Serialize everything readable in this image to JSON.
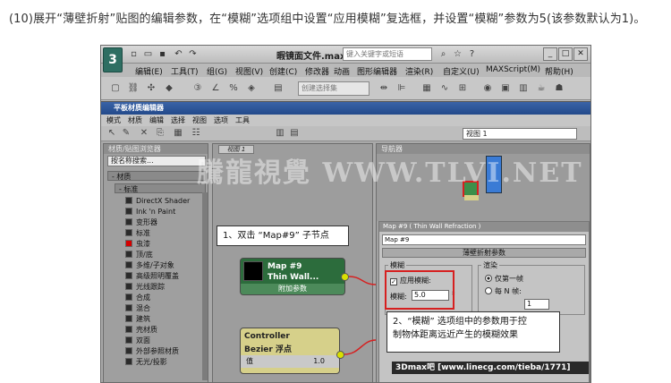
{
  "caption": "(10)展开“薄壁折射”贴图的编辑参数，在“模糊”选项组中设置“应用模糊”复选框，并设置“模糊”参数为5(该参数默认为1)。",
  "app": {
    "doc_title": "暇镜面文件.max",
    "search_placeholder": "键入关键字或短语",
    "logo": "3",
    "menu": [
      "编辑(E)",
      "工具(T)",
      "组(G)",
      "视图(V)",
      "创建(C)",
      "修改器",
      "动画",
      "图形编辑器",
      "渲染(R)",
      "自定义(U)",
      "MAXScript(M)",
      "帮助(H)"
    ],
    "selection_set_placeholder": "创建选择集"
  },
  "sme": {
    "title": "平板材质编辑器",
    "menu": [
      "模式",
      "材质",
      "编辑",
      "选择",
      "视图",
      "选项",
      "工具"
    ],
    "view_select": "视图 1",
    "browser": {
      "header": "材质/贴图浏览器",
      "search": "按名称搜索...",
      "group_materials": "- 材质",
      "group_standard": "- 标准",
      "items": [
        {
          "label": "DirectX Shader",
          "red": false
        },
        {
          "label": "Ink 'n Paint",
          "red": false
        },
        {
          "label": "变形器",
          "red": false
        },
        {
          "label": "标准",
          "red": false
        },
        {
          "label": "虫漆",
          "red": true
        },
        {
          "label": "顶/底",
          "red": false
        },
        {
          "label": "多维/子对象",
          "red": false
        },
        {
          "label": "高级照明覆盖",
          "red": false
        },
        {
          "label": "光线跟踪",
          "red": false
        },
        {
          "label": "合成",
          "red": false
        },
        {
          "label": "混合",
          "red": false
        },
        {
          "label": "建筑",
          "red": false
        },
        {
          "label": "壳材质",
          "red": false
        },
        {
          "label": "双面",
          "red": false
        },
        {
          "label": "外部参照材质",
          "red": false
        },
        {
          "label": "无光/投影",
          "red": false
        }
      ]
    },
    "view_tab": "视图 1",
    "node_map": {
      "title": "Map #9",
      "subtitle": "Thin Wall...",
      "footer": "附加参数"
    },
    "node_controller": {
      "title": "Controller",
      "subtitle": "Bezier 浮点",
      "row_label": "值",
      "row_value": "1.0"
    },
    "navigator_header": "导航器",
    "params": {
      "header": "Map #9  ( Thin Wall Refraction )",
      "name": "Map #9",
      "rollout": "薄壁折射参数",
      "blur_group": "模糊",
      "apply_blur": "应用模糊:",
      "apply_blur_checked": "✓",
      "blur_label": "模糊:",
      "blur_value": "5.0",
      "render_group": "渲染",
      "radio_first_frame": "仅第一帧",
      "radio_every_n": "每 N 帧:",
      "n_value": "1"
    }
  },
  "callout1": "1、双击 “Map#9” 子节点",
  "callout2_line1": "2、“模糊” 选项组中的参数用于控",
  "callout2_line2": "制物体距离远近产生的模糊效果",
  "watermark": "騰龍視覺 WWW.TLVI.NET",
  "footer": "3Dmax吧  [www.linecg.com/tieba/1771]"
}
